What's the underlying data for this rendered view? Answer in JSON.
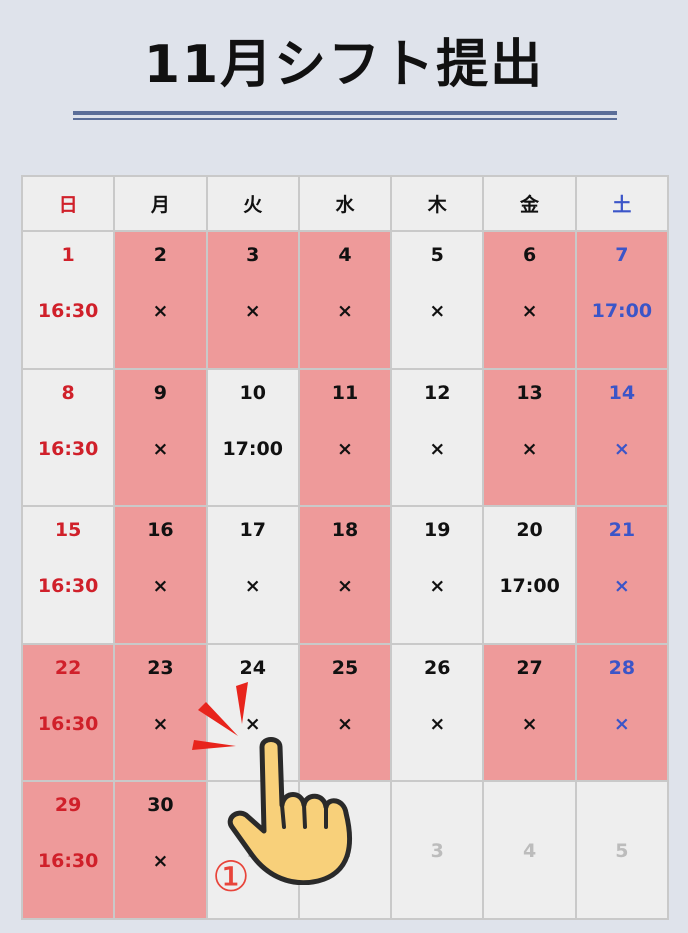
{
  "title": "11月シフト提出",
  "weekdays": [
    "日",
    "月",
    "火",
    "水",
    "木",
    "金",
    "土"
  ],
  "days": [
    {
      "num": "1",
      "val": "16:30"
    },
    {
      "num": "2",
      "val": "×"
    },
    {
      "num": "3",
      "val": "×"
    },
    {
      "num": "4",
      "val": "×"
    },
    {
      "num": "5",
      "val": "×"
    },
    {
      "num": "6",
      "val": "×"
    },
    {
      "num": "7",
      "val": "17:00"
    },
    {
      "num": "8",
      "val": "16:30"
    },
    {
      "num": "9",
      "val": "×"
    },
    {
      "num": "10",
      "val": "17:00"
    },
    {
      "num": "11",
      "val": "×"
    },
    {
      "num": "12",
      "val": "×"
    },
    {
      "num": "13",
      "val": "×"
    },
    {
      "num": "14",
      "val": "×"
    },
    {
      "num": "15",
      "val": "16:30"
    },
    {
      "num": "16",
      "val": "×"
    },
    {
      "num": "17",
      "val": "×"
    },
    {
      "num": "18",
      "val": "×"
    },
    {
      "num": "19",
      "val": "×"
    },
    {
      "num": "20",
      "val": "17:00"
    },
    {
      "num": "21",
      "val": "×"
    },
    {
      "num": "22",
      "val": "16:30"
    },
    {
      "num": "23",
      "val": "×"
    },
    {
      "num": "24",
      "val": "×"
    },
    {
      "num": "25",
      "val": "×"
    },
    {
      "num": "26",
      "val": "×"
    },
    {
      "num": "27",
      "val": "×"
    },
    {
      "num": "28",
      "val": "×"
    },
    {
      "num": "29",
      "val": "16:30"
    },
    {
      "num": "30",
      "val": "×"
    },
    {
      "num": "1",
      "val": ""
    },
    {
      "num": "2",
      "val": ""
    },
    {
      "num": "3",
      "val": ""
    },
    {
      "num": "4",
      "val": ""
    },
    {
      "num": "5",
      "val": ""
    }
  ],
  "annotation": {
    "step_label": "①"
  },
  "colors": {
    "sunday": "#d0202a",
    "saturday": "#3b55c8",
    "highlight": "#ee9a9a",
    "normal": "#eeeeee"
  }
}
